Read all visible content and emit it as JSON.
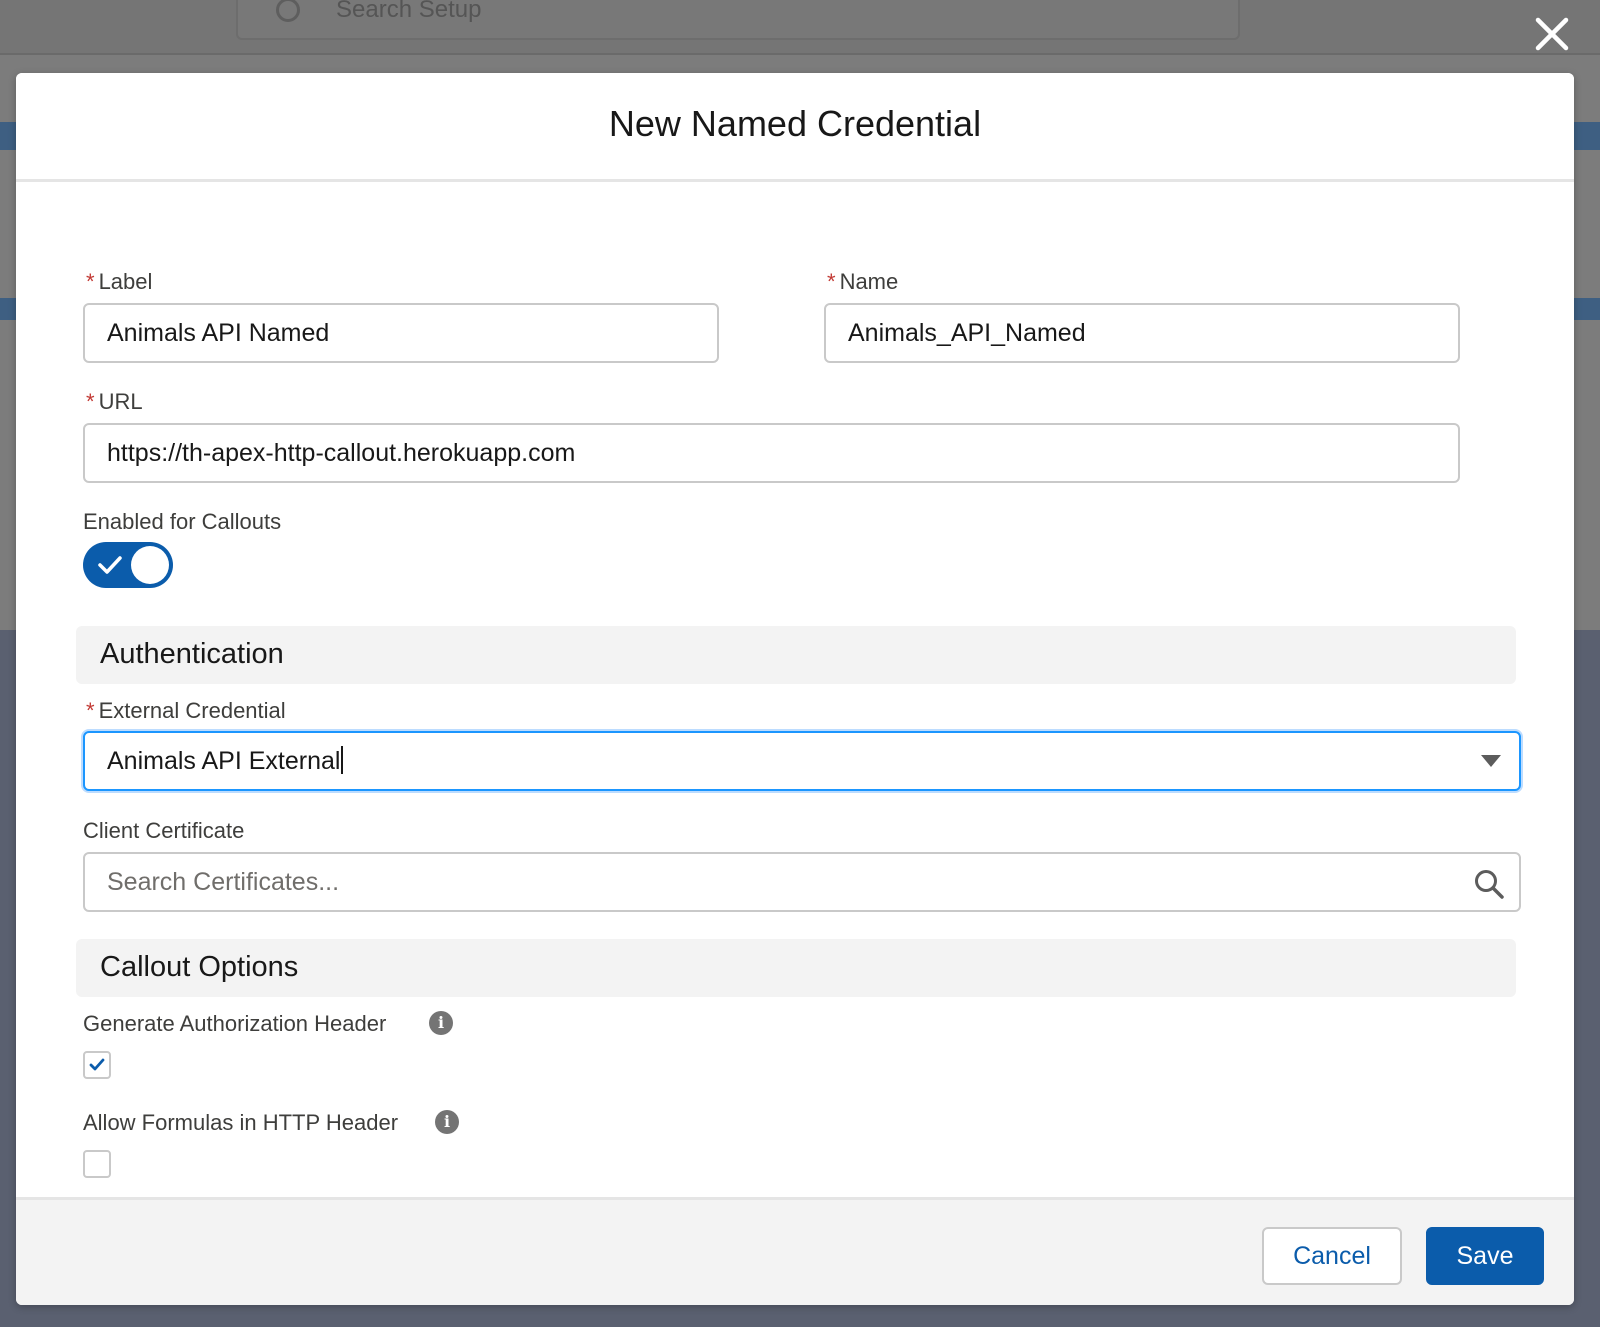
{
  "background": {
    "search_placeholder": "Search Setup"
  },
  "modal": {
    "title": "New Named Credential",
    "fields": {
      "label": {
        "label": "Label",
        "required_mark": "*",
        "value": "Animals API Named"
      },
      "name": {
        "label": "Name",
        "required_mark": "*",
        "value": "Animals_API_Named"
      },
      "url": {
        "label": "URL",
        "required_mark": "*",
        "value": "https://th-apex-http-callout.herokuapp.com"
      },
      "enabled_for_callouts": {
        "label": "Enabled for Callouts",
        "checked": true
      }
    },
    "authentication": {
      "title": "Authentication",
      "external_credential": {
        "label": "External Credential",
        "required_mark": "*",
        "value": "Animals API External"
      },
      "client_certificate": {
        "label": "Client Certificate",
        "placeholder": "Search Certificates..."
      }
    },
    "callout_options": {
      "title": "Callout Options",
      "generate_auth_header": {
        "label": "Generate Authorization Header",
        "checked": true
      },
      "allow_formulas": {
        "label": "Allow Formulas in HTTP Header",
        "checked": false
      }
    },
    "footer": {
      "cancel_label": "Cancel",
      "save_label": "Save"
    }
  },
  "colors": {
    "brand_blue": "#0b5cab",
    "focus_blue": "#1b96ff",
    "required_red": "#c23934"
  },
  "icons": {
    "close": "close-icon",
    "toggle_check": "check-icon",
    "dropdown": "chevron-down-icon",
    "search": "search-icon",
    "info": "info-icon",
    "checkbox_check": "check-icon"
  }
}
